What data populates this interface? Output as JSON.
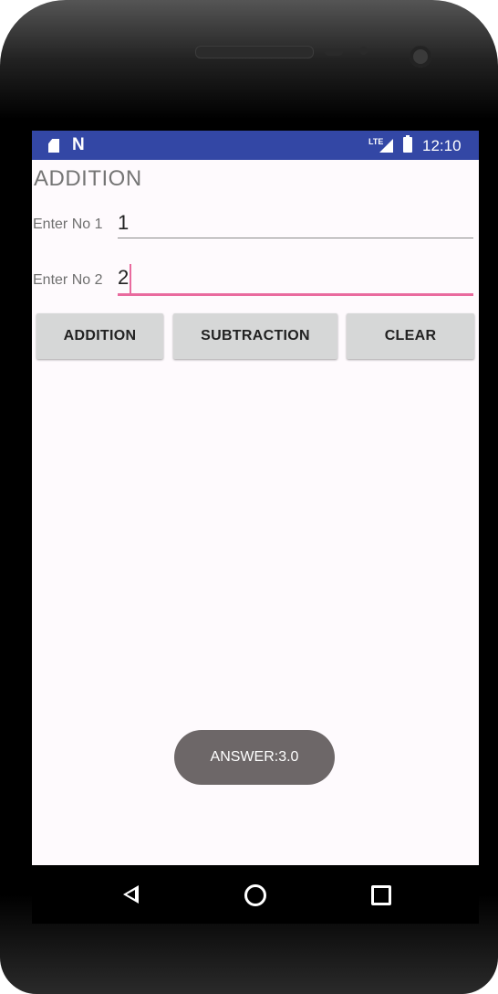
{
  "status_bar": {
    "lte_label": "LTE",
    "time": "12:10",
    "color": "#3347a5"
  },
  "app": {
    "title": "ADDITION",
    "field1_label": "Enter No 1",
    "field1_value": "1",
    "field2_label": "Enter No 2",
    "field2_value": "2",
    "accent_color": "#e96a9e"
  },
  "buttons": {
    "addition": "ADDITION",
    "subtraction": "SUBTRACTION",
    "clear": "CLEAR"
  },
  "toast": {
    "text": "ANSWER:3.0"
  },
  "nav": {
    "back_icon": "back-triangle-icon",
    "home_icon": "home-circle-icon",
    "recent_icon": "recents-square-icon"
  }
}
